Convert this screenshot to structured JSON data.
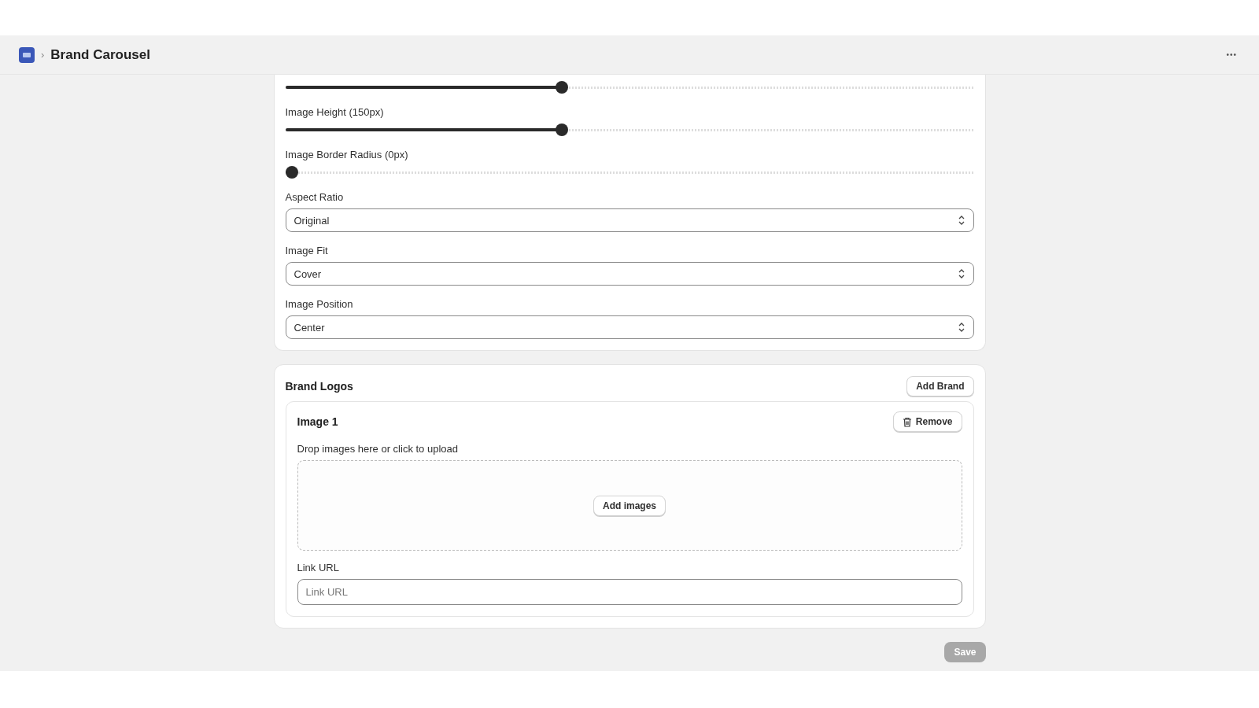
{
  "header": {
    "title": "Brand Carousel",
    "separator": "›",
    "more": "•••"
  },
  "settings": {
    "sliders": [
      {
        "level": 0.4
      },
      {
        "label": "Image Height (150px)",
        "level": 0.4
      },
      {
        "label": "Image Border Radius (0px)",
        "level": 0
      }
    ],
    "selects": [
      {
        "label": "Aspect Ratio",
        "value": "Original"
      },
      {
        "label": "Image Fit",
        "value": "Cover"
      },
      {
        "label": "Image Position",
        "value": "Center"
      }
    ]
  },
  "brand_logos": {
    "title": "Brand Logos",
    "add_button": "Add Brand",
    "items": [
      {
        "title": "Image 1",
        "remove_button": "Remove",
        "drop_label": "Drop images here or click to upload",
        "add_images_button": "Add images",
        "link_label": "Link URL",
        "link_placeholder": "Link URL"
      }
    ]
  },
  "save_button": {
    "label": "Save",
    "disabled": true
  }
}
